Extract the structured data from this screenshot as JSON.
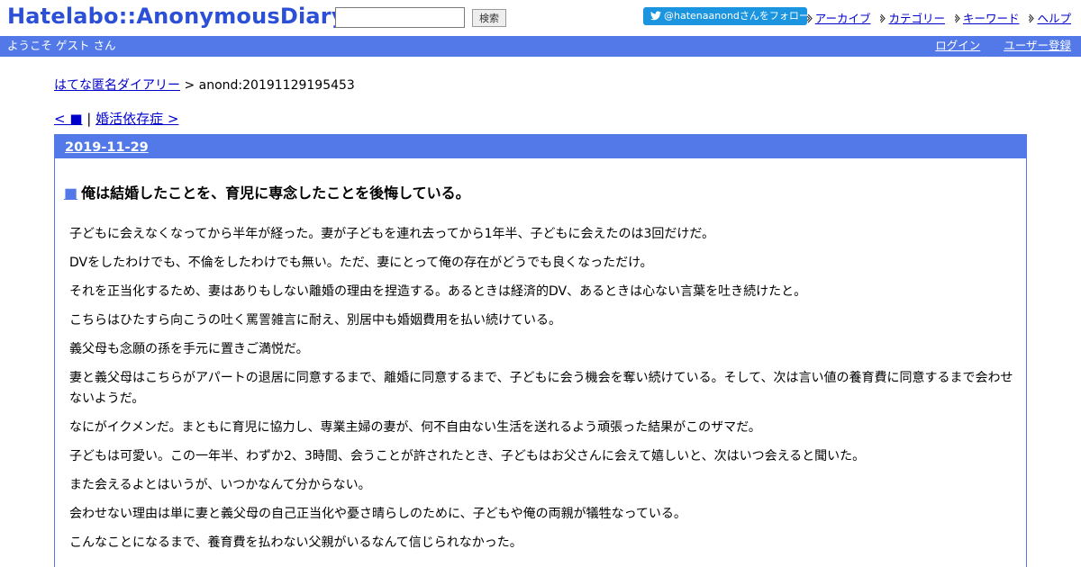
{
  "header": {
    "logo": "Hatelabo::AnonymousDiary",
    "search_placeholder": "",
    "search_button": "検索",
    "twitter_follow": "@hatenaanondさんをフォロー",
    "nav": [
      "アーカイブ",
      "カテゴリー",
      "キーワード",
      "ヘルプ"
    ]
  },
  "userbar": {
    "welcome": "ようこそ ゲスト さん",
    "login": "ログイン",
    "register": "ユーザー登録"
  },
  "breadcrumb": {
    "root": "はてな匿名ダイアリー",
    "separator": " > ",
    "current": "anond:20191129195453"
  },
  "pager": {
    "prev": "< ■",
    "separator": " | ",
    "next": "婚活依存症 >"
  },
  "entry": {
    "date": "2019-11-29",
    "anchor": "■",
    "title": "俺は結婚したことを、育児に専念したことを後悔している。",
    "paragraphs": [
      "子どもに会えなくなってから半年が経った。妻が子どもを連れ去ってから1年半、子どもに会えたのは3回だけだ。",
      "DVをしたわけでも、不倫をしたわけでも無い。ただ、妻にとって俺の存在がどうでも良くなっただけ。",
      "それを正当化するため、妻はありもしない離婚の理由を捏造する。あるときは経済的DV、あるときは心ない言葉を吐き続けたと。",
      "こちらはひたすら向こうの吐く罵詈雑言に耐え、別居中も婚姻費用を払い続けている。",
      "義父母も念願の孫を手元に置きご満悦だ。",
      "妻と義父母はこちらがアパートの退居に同意するまで、離婚に同意するまで、子どもに会う機会を奪い続けている。そして、次は言い値の養育費に同意するまで会わせないようだ。",
      "なにがイクメンだ。まともに育児に協力し、専業主婦の妻が、何不自由ない生活を送れるよう頑張った結果がこのザマだ。",
      "子どもは可愛い。この一年半、わずか2、3時間、会うことが許されたとき、子どもはお父さんに会えて嬉しいと、次はいつ会えると聞いた。",
      "また会えるよとはいうが、いつかなんて分からない。",
      "会わせない理由は単に妻と義父母の自己正当化や憂さ晴らしのために、子どもや俺の両親が犠牲なっている。",
      "こんなことになるまで、養育費を払わない父親がいるなんて信じられなかった。"
    ]
  },
  "colors": {
    "accent": "#5279e7",
    "logo": "#2b4fd6",
    "twitter": "#1b95e0",
    "link": "#0000cc"
  }
}
